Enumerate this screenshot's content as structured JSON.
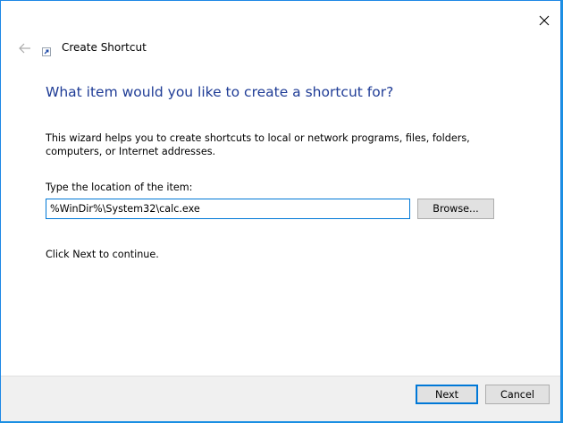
{
  "window": {
    "title": "Create Shortcut",
    "accent_color": "#0078d7",
    "heading_color": "#1f3c96"
  },
  "icons": {
    "back": "back-arrow-icon",
    "close": "close-icon",
    "shortcut": "shortcut-icon"
  },
  "main": {
    "heading": "What item would you like to create a shortcut for?",
    "description": "This wizard helps you to create shortcuts to local or network programs, files, folders, computers, or Internet addresses.",
    "location_label": "Type the location of the item:",
    "location_value": "%WinDir%\\System32\\calc.exe",
    "browse_label": "Browse...",
    "continue_text": "Click Next to continue."
  },
  "footer": {
    "next_label": "Next",
    "cancel_label": "Cancel"
  }
}
